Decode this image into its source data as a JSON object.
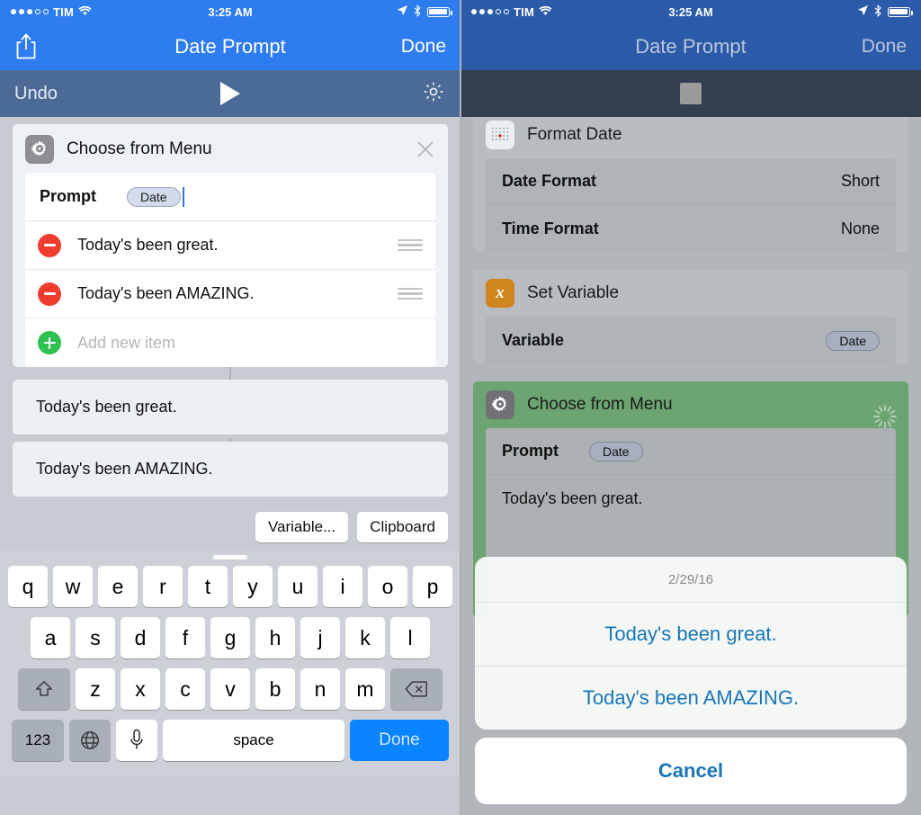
{
  "status_bar": {
    "signal_filled": 3,
    "signal_empty": 2,
    "carrier": "TIM",
    "time": "3:25 AM",
    "wifi_icon": "wifi-icon",
    "location_icon": "location-arrow-icon",
    "bluetooth_icon": "bluetooth-icon",
    "battery_icon": "battery-full-icon"
  },
  "colors": {
    "navbar_blue": "#2d7cf0",
    "navbar_blue_dim": "#2b5aa8",
    "toolbar_slate": "#4b6a96",
    "toolbar_slate_dim": "#333f50",
    "workflow_green": "#6da572",
    "accent_blue": "#1877b8",
    "delete_red": "#f03b2f",
    "add_green": "#2ec14f",
    "variable_orange": "#d1851f",
    "key_blue": "#0a84ff"
  },
  "left_phone": {
    "navbar": {
      "title": "Date Prompt",
      "done_label": "Done",
      "share_icon": "share-icon"
    },
    "toolbar": {
      "undo_label": "Undo",
      "run_icon": "play-icon",
      "settings_icon": "gear-icon"
    },
    "action_card": {
      "icon": "gear-app-icon",
      "title": "Choose from Menu",
      "close_icon": "close-x-icon",
      "prompt_label": "Prompt",
      "prompt_token": "Date",
      "items": [
        {
          "text": "Today's been great.",
          "delete_icon": "minus-circle-icon",
          "grip_icon": "reorder-grip-icon"
        },
        {
          "text": "Today's been AMAZING.",
          "delete_icon": "minus-circle-icon",
          "grip_icon": "reorder-grip-icon"
        }
      ],
      "add_new_placeholder": "Add new item",
      "add_icon": "plus-circle-icon"
    },
    "menu_blocks": [
      {
        "text": "Today's been great."
      },
      {
        "text": "Today's been AMAZING."
      }
    ],
    "accessory_bar": {
      "variable_label": "Variable...",
      "clipboard_label": "Clipboard"
    },
    "keyboard": {
      "row1": [
        "q",
        "w",
        "e",
        "r",
        "t",
        "y",
        "u",
        "i",
        "o",
        "p"
      ],
      "row2": [
        "a",
        "s",
        "d",
        "f",
        "g",
        "h",
        "j",
        "k",
        "l"
      ],
      "row3": [
        "z",
        "x",
        "c",
        "v",
        "b",
        "n",
        "m"
      ],
      "shift_icon": "shift-arrow-icon",
      "backspace_icon": "backspace-icon",
      "numbers_label": "123",
      "globe_icon": "globe-icon",
      "mic_icon": "microphone-icon",
      "space_label": "space",
      "done_label": "Done"
    }
  },
  "right_phone": {
    "navbar": {
      "title": "Date Prompt",
      "done_label": "Done"
    },
    "toolbar": {
      "stop_icon": "stop-square-icon"
    },
    "cards": [
      {
        "icon": "calendar-icon",
        "title": "Format Date",
        "rows": [
          {
            "label": "Date Format",
            "value": "Short"
          },
          {
            "label": "Time Format",
            "value": "None"
          }
        ]
      },
      {
        "icon": "variable-x-icon",
        "title": "Set Variable",
        "rows": [
          {
            "label": "Variable",
            "token": "Date"
          }
        ]
      },
      {
        "icon": "gear-app-icon",
        "title": "Choose from Menu",
        "spinner_icon": "activity-spinner-icon",
        "prompt_label": "Prompt",
        "prompt_token": "Date",
        "rows": [
          {
            "plain": "Today's been great."
          }
        ]
      }
    ],
    "action_sheet": {
      "title": "2/29/16",
      "options": [
        "Today's been great.",
        "Today's been AMAZING."
      ],
      "cancel_label": "Cancel"
    }
  }
}
